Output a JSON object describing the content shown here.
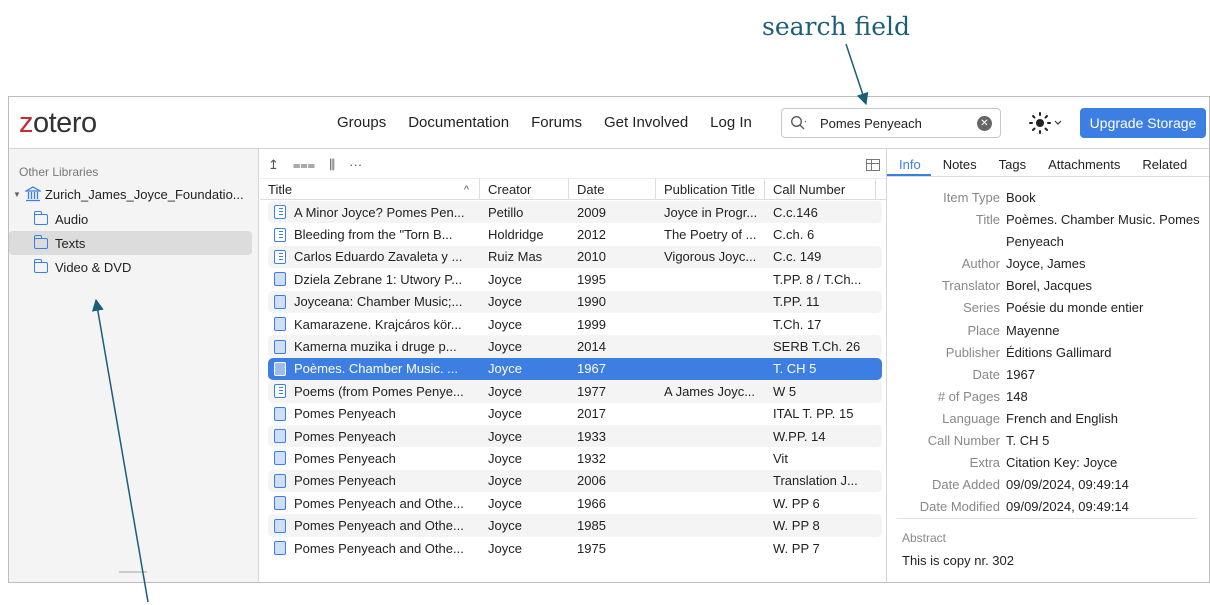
{
  "annotation": {
    "label": "search field"
  },
  "header": {
    "logo_z": "z",
    "logo_rest": "otero",
    "nav": [
      "Groups",
      "Documentation",
      "Forums",
      "Get Involved",
      "Log In"
    ],
    "search_value": "Pomes Penyeach",
    "theme_icon": "sun-icon",
    "upgrade_label": "Upgrade Storage"
  },
  "sidebar": {
    "heading": "Other Libraries",
    "library": "Zurich_James_Joyce_Foundatio...",
    "collections": [
      "Audio",
      "Texts",
      "Video & DVD"
    ],
    "selected_collection": "Texts"
  },
  "items": {
    "toolbar": [
      "↥",
      "⩶",
      "⫼",
      "···"
    ],
    "columns": [
      "Title",
      "Creator",
      "Date",
      "Publication Title",
      "Call Number"
    ],
    "sort_indicator": "^",
    "rows": [
      {
        "title": "A Minor Joyce? Pomes Pen...",
        "creator": "Petillo",
        "date": "2009",
        "pub": "Joyce in Progr...",
        "call": "C.c.146",
        "type": "section"
      },
      {
        "title": "Bleeding from the \"Torn B...",
        "creator": "Holdridge",
        "date": "2012",
        "pub": "The Poetry of ...",
        "call": "C.ch. 6",
        "type": "section"
      },
      {
        "title": "Carlos Eduardo Zavaleta y ...",
        "creator": "Ruiz Mas",
        "date": "2010",
        "pub": "Vigorous Joyc...",
        "call": "C.c. 149",
        "type": "section"
      },
      {
        "title": "Dziela Zebrane 1: Utwory P...",
        "creator": "Joyce",
        "date": "1995",
        "pub": "",
        "call": "T.PP. 8 / T.Ch...",
        "type": "book"
      },
      {
        "title": "Joyceana: Chamber Music;...",
        "creator": "Joyce",
        "date": "1990",
        "pub": "",
        "call": "T.PP. 11",
        "type": "book"
      },
      {
        "title": "Kamarazene. Krajcáros kör...",
        "creator": "Joyce",
        "date": "1999",
        "pub": "",
        "call": "T.Ch. 17",
        "type": "book"
      },
      {
        "title": "Kamerna muzika i druge p...",
        "creator": "Joyce",
        "date": "2014",
        "pub": "",
        "call": "SERB T.Ch. 26",
        "type": "book"
      },
      {
        "title": "Poèmes. Chamber Music. ...",
        "creator": "Joyce",
        "date": "1967",
        "pub": "",
        "call": "T. CH 5",
        "type": "book",
        "selected": true
      },
      {
        "title": "Poems (from Pomes Penye...",
        "creator": "Joyce",
        "date": "1977",
        "pub": "A James Joyc...",
        "call": "W 5",
        "type": "section"
      },
      {
        "title": "Pomes Penyeach",
        "creator": "Joyce",
        "date": "2017",
        "pub": "",
        "call": "ITAL T. PP. 15",
        "type": "book"
      },
      {
        "title": "Pomes Penyeach",
        "creator": "Joyce",
        "date": "1933",
        "pub": "",
        "call": "W.PP. 14",
        "type": "book"
      },
      {
        "title": "Pomes Penyeach",
        "creator": "Joyce",
        "date": "1932",
        "pub": "",
        "call": "Vit",
        "type": "book"
      },
      {
        "title": "Pomes Penyeach",
        "creator": "Joyce",
        "date": "2006",
        "pub": "",
        "call": "Translation J...",
        "type": "book"
      },
      {
        "title": "Pomes Penyeach and Othe...",
        "creator": "Joyce",
        "date": "1966",
        "pub": "",
        "call": "W. PP 6",
        "type": "book"
      },
      {
        "title": "Pomes Penyeach and Othe...",
        "creator": "Joyce",
        "date": "1985",
        "pub": "",
        "call": "W. PP 8",
        "type": "book"
      },
      {
        "title": "Pomes Penyeach and Othe...",
        "creator": "Joyce",
        "date": "1975",
        "pub": "",
        "call": "W. PP 7",
        "type": "book"
      }
    ]
  },
  "pane": {
    "tabs": [
      "Info",
      "Notes",
      "Tags",
      "Attachments",
      "Related"
    ],
    "active_tab": "Info",
    "fields": [
      {
        "label": "Item Type",
        "value": "Book"
      },
      {
        "label": "Title",
        "value": "Poèmes. Chamber Music. Pomes Penyeach"
      },
      {
        "label": "Author",
        "value": "Joyce, James"
      },
      {
        "label": "Translator",
        "value": "Borel, Jacques"
      },
      {
        "label": "Series",
        "value": "Poésie du monde entier"
      },
      {
        "label": "Place",
        "value": "Mayenne"
      },
      {
        "label": "Publisher",
        "value": "Éditions Gallimard"
      },
      {
        "label": "Date",
        "value": "1967"
      },
      {
        "label": "# of Pages",
        "value": "148"
      },
      {
        "label": "Language",
        "value": "French and English"
      },
      {
        "label": "Call Number",
        "value": "T. CH 5"
      },
      {
        "label": "Extra",
        "value": "Citation Key: Joyce"
      },
      {
        "label": "Date Added",
        "value": "09/09/2024, 09:49:14"
      },
      {
        "label": "Date Modified",
        "value": "09/09/2024, 09:49:14"
      }
    ],
    "abstract_heading": "Abstract",
    "abstract_value": "This is copy nr. 302"
  },
  "colors": {
    "accent": "#3d7ee2",
    "logo_red": "#cc2936",
    "annotation": "#1b5e7a"
  }
}
